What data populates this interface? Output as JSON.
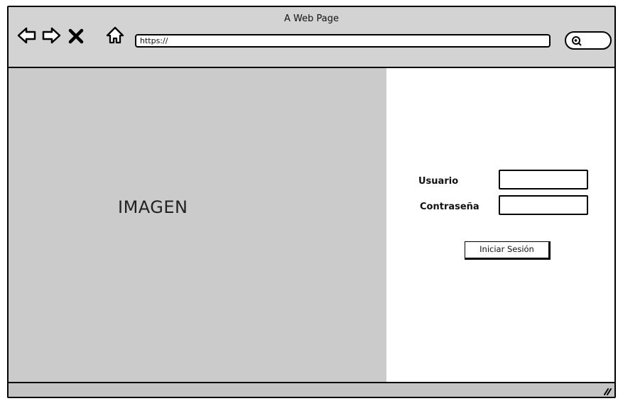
{
  "window": {
    "title": "A Web Page"
  },
  "toolbar": {
    "url": "https://",
    "icons": [
      "back-arrow-icon",
      "forward-arrow-icon",
      "close-icon",
      "home-icon",
      "search-icon"
    ]
  },
  "image_panel": {
    "label": "IMAGEN"
  },
  "login_form": {
    "username_label": "Usuario",
    "username_value": "",
    "password_label": "Contraseña",
    "password_value": "",
    "submit_label": "Iniciar Sesión"
  },
  "statusbar": {
    "icon": "resize-grip-icon"
  }
}
